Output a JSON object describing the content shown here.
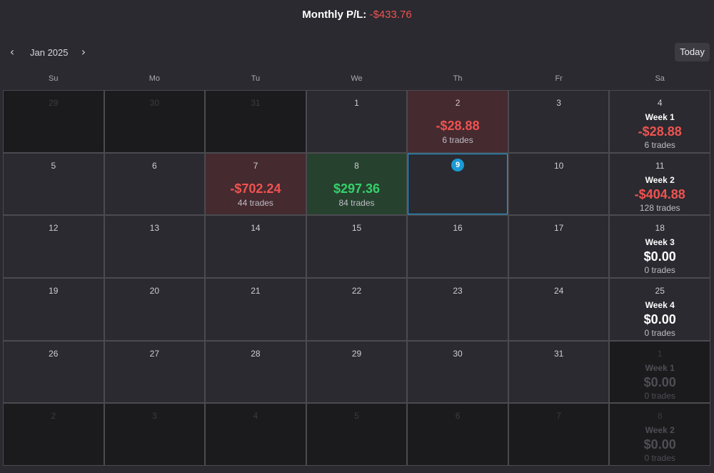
{
  "header": {
    "monthly_label": "Monthly P/L:",
    "monthly_value": "-$433.76",
    "negative_color": "#ef5350"
  },
  "toolbar": {
    "prev_icon": "chevron-left-icon",
    "next_icon": "chevron-right-icon",
    "prev_glyph": "‹",
    "next_glyph": "›",
    "month": "Jan 2025",
    "today_label": "Today"
  },
  "weekdays": [
    "Su",
    "Mo",
    "Tu",
    "We",
    "Th",
    "Fr",
    "Sa"
  ],
  "colors": {
    "accent": "#1a9ad6",
    "gain": "#34d16a",
    "loss": "#ef5350"
  },
  "weeks": [
    {
      "days": [
        {
          "num": "29",
          "outside": true
        },
        {
          "num": "30",
          "outside": true
        },
        {
          "num": "31",
          "outside": true
        },
        {
          "num": "1"
        },
        {
          "num": "2",
          "status": "loss",
          "pnl": "-$28.88",
          "trades": "6 trades"
        },
        {
          "num": "3"
        },
        {
          "num": "4"
        }
      ],
      "summary": {
        "label": "Week 1",
        "pnl": "-$28.88",
        "trades": "6 trades",
        "status": "loss"
      }
    },
    {
      "days": [
        {
          "num": "5"
        },
        {
          "num": "6"
        },
        {
          "num": "7",
          "status": "loss",
          "pnl": "-$702.24",
          "trades": "44 trades"
        },
        {
          "num": "8",
          "status": "gain",
          "pnl": "$297.36",
          "trades": "84 trades"
        },
        {
          "num": "9",
          "today": true
        },
        {
          "num": "10"
        },
        {
          "num": "11"
        }
      ],
      "summary": {
        "label": "Week 2",
        "pnl": "-$404.88",
        "trades": "128 trades",
        "status": "loss"
      }
    },
    {
      "days": [
        {
          "num": "12"
        },
        {
          "num": "13"
        },
        {
          "num": "14"
        },
        {
          "num": "15"
        },
        {
          "num": "16"
        },
        {
          "num": "17"
        },
        {
          "num": "18"
        }
      ],
      "summary": {
        "label": "Week 3",
        "pnl": "$0.00",
        "trades": "0 trades"
      }
    },
    {
      "days": [
        {
          "num": "19"
        },
        {
          "num": "20"
        },
        {
          "num": "21"
        },
        {
          "num": "22"
        },
        {
          "num": "23"
        },
        {
          "num": "24"
        },
        {
          "num": "25"
        }
      ],
      "summary": {
        "label": "Week 4",
        "pnl": "$0.00",
        "trades": "0 trades"
      }
    },
    {
      "days": [
        {
          "num": "26"
        },
        {
          "num": "27"
        },
        {
          "num": "28"
        },
        {
          "num": "29"
        },
        {
          "num": "30"
        },
        {
          "num": "31"
        },
        {
          "num": "1",
          "outside": true
        }
      ],
      "summary": {
        "label": "Week 1",
        "pnl": "$0.00",
        "trades": "0 trades"
      }
    },
    {
      "days": [
        {
          "num": "2",
          "outside": true
        },
        {
          "num": "3",
          "outside": true
        },
        {
          "num": "4",
          "outside": true
        },
        {
          "num": "5",
          "outside": true
        },
        {
          "num": "6",
          "outside": true
        },
        {
          "num": "7",
          "outside": true
        },
        {
          "num": "8",
          "outside": true
        }
      ],
      "summary": {
        "label": "Week 2",
        "pnl": "$0.00",
        "trades": "0 trades"
      }
    }
  ]
}
